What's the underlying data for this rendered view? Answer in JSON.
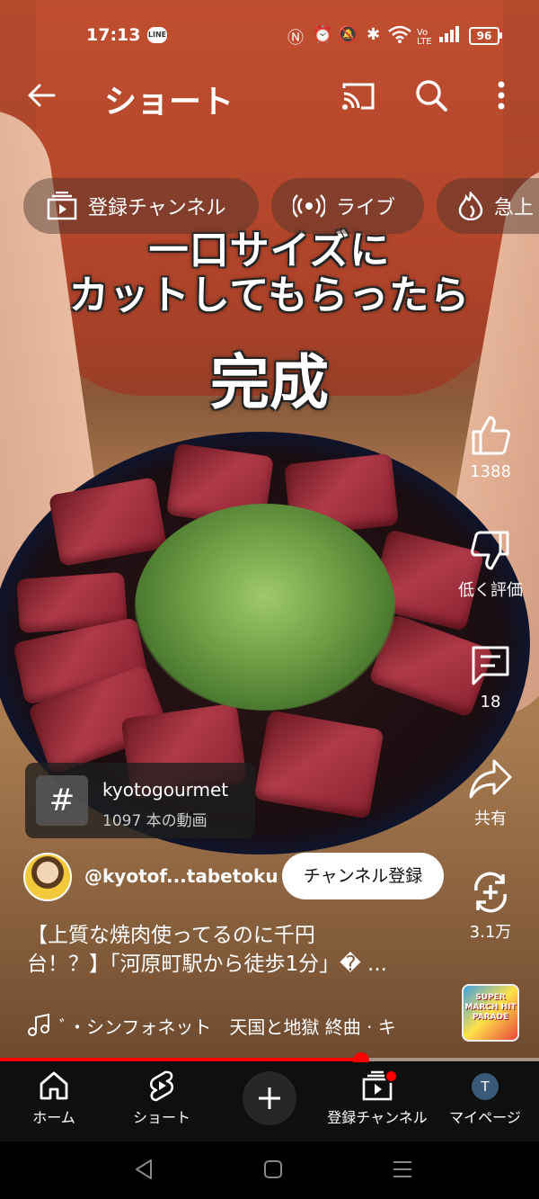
{
  "status": {
    "time": "17:13",
    "line_badge": "LINE",
    "battery": "96"
  },
  "header": {
    "title": "ショート"
  },
  "chips": [
    {
      "label": "登録チャンネル",
      "icon": "subscriptions-icon"
    },
    {
      "label": "ライブ",
      "icon": "live-icon"
    },
    {
      "label": "急上",
      "icon": "trending-icon"
    }
  ],
  "overlay_text": {
    "line1": "一口サイズに",
    "line2": "カットしてもらったら",
    "line3": "完成"
  },
  "actions": {
    "like_count": "1388",
    "dislike_label": "低く評価",
    "comment_count": "18",
    "share_label": "共有",
    "remix_count": "3.1万"
  },
  "hashtag": {
    "symbol": "#",
    "name": "kyotogourmet",
    "count": "1097 本の動画"
  },
  "channel": {
    "handle": "@kyotof...tabetoku",
    "subscribe_label": "チャンネル登録"
  },
  "video": {
    "title_line1": "【上質な焼肉使ってるのに千円",
    "title_line2": "台！？】「河原町駅から徒歩1分」� ..."
  },
  "music": {
    "text": "ﾞ・シンフォネット　天国と地獄 終曲 · キ",
    "album_art_text": "SUPER MARCH HIT PARADE"
  },
  "progress": {
    "fraction": 0.67
  },
  "nav": {
    "home": "ホーム",
    "shorts": "ショート",
    "subscriptions": "登録チャンネル",
    "mypage": "マイページ",
    "avatar_letter": "T"
  },
  "colors": {
    "accent": "#ff0000",
    "nav_bg": "#0f0f0f",
    "chip_bg": "#46322d"
  }
}
